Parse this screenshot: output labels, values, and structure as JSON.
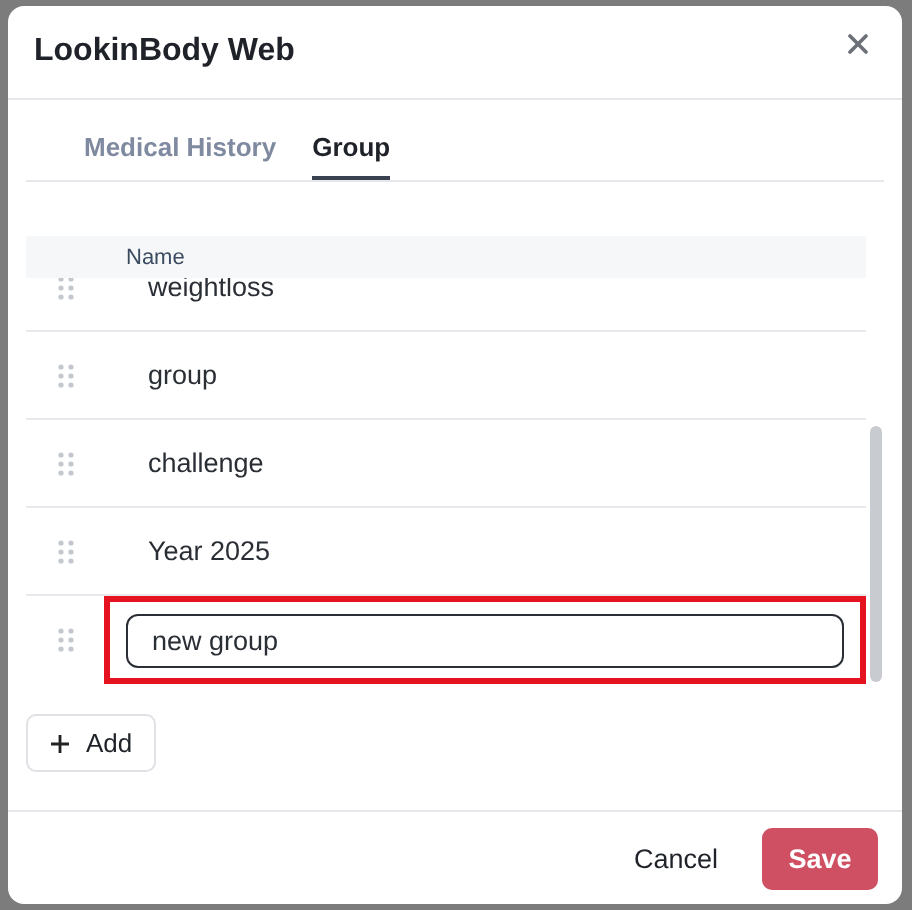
{
  "dialog": {
    "title": "LookinBody Web"
  },
  "tabs": [
    {
      "label": "Medical History",
      "selected": false
    },
    {
      "label": "Group",
      "selected": true
    }
  ],
  "table": {
    "columns": [
      "Name"
    ],
    "rows": [
      {
        "kind": "text",
        "name": "weightloss"
      },
      {
        "kind": "text",
        "name": "group"
      },
      {
        "kind": "text",
        "name": "challenge"
      },
      {
        "kind": "text",
        "name": "Year 2025"
      },
      {
        "kind": "input",
        "value": "new group",
        "highlighted": true
      }
    ]
  },
  "add_button": "Add",
  "buttons": {
    "cancel": "Cancel",
    "save": "Save"
  }
}
